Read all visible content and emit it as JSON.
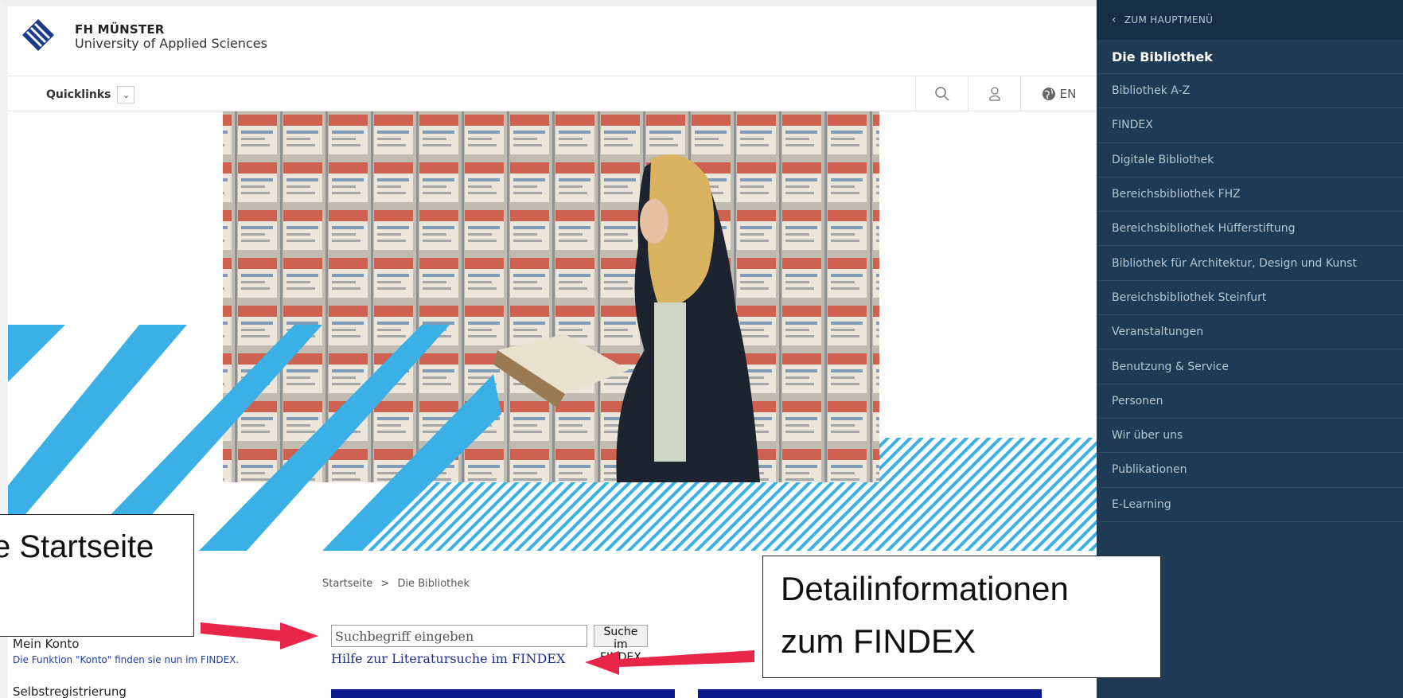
{
  "header": {
    "logo_line1": "FH MÜNSTER",
    "logo_line2": "University of Applied Sciences"
  },
  "navbar": {
    "quicklinks_label": "Quicklinks",
    "lang_label": "EN",
    "icons": [
      "search-icon",
      "user-icon",
      "globe-icon"
    ]
  },
  "breadcrumb": {
    "home": "Startseite",
    "separator": ">",
    "current": "Die Bibliothek"
  },
  "account": {
    "title": "Mein Konto",
    "note": "Die Funktion \"Konto\" finden sie nun im FINDEX.",
    "self_registration": "Selbstregistrierung"
  },
  "search": {
    "placeholder": "Suchbegriff eingeben",
    "button_label": "Suche im FINDEX",
    "help_link": "Hilfe zur Literatursuche im FINDEX"
  },
  "sidemenu": {
    "back_label": "ZUM HAUPTMENÜ",
    "heading": "Die Bibliothek",
    "items": [
      "Bibliothek A-Z",
      "FINDEX",
      "Digitale Bibliothek",
      "Bereichsbibliothek FHZ",
      "Bereichsbibliothek Hüfferstiftung",
      "Bibliothek für Architektur, Design und Kunst",
      "Bereichsbibliothek Steinfurt",
      "Veranstaltungen",
      "Benutzung & Service",
      "Personen",
      "Wir über uns",
      "Publikationen",
      "E-Learning"
    ]
  },
  "annotations": {
    "left_callout": "e Startseite",
    "right_callout_line1": "Detailinformationen",
    "right_callout_line2": "zum FINDEX"
  },
  "colors": {
    "menu_bg": "#1f3a55",
    "stripe_blue": "#3bb0e6",
    "box_blue": "#0a1a8c",
    "arrow_red": "#e8264a"
  }
}
